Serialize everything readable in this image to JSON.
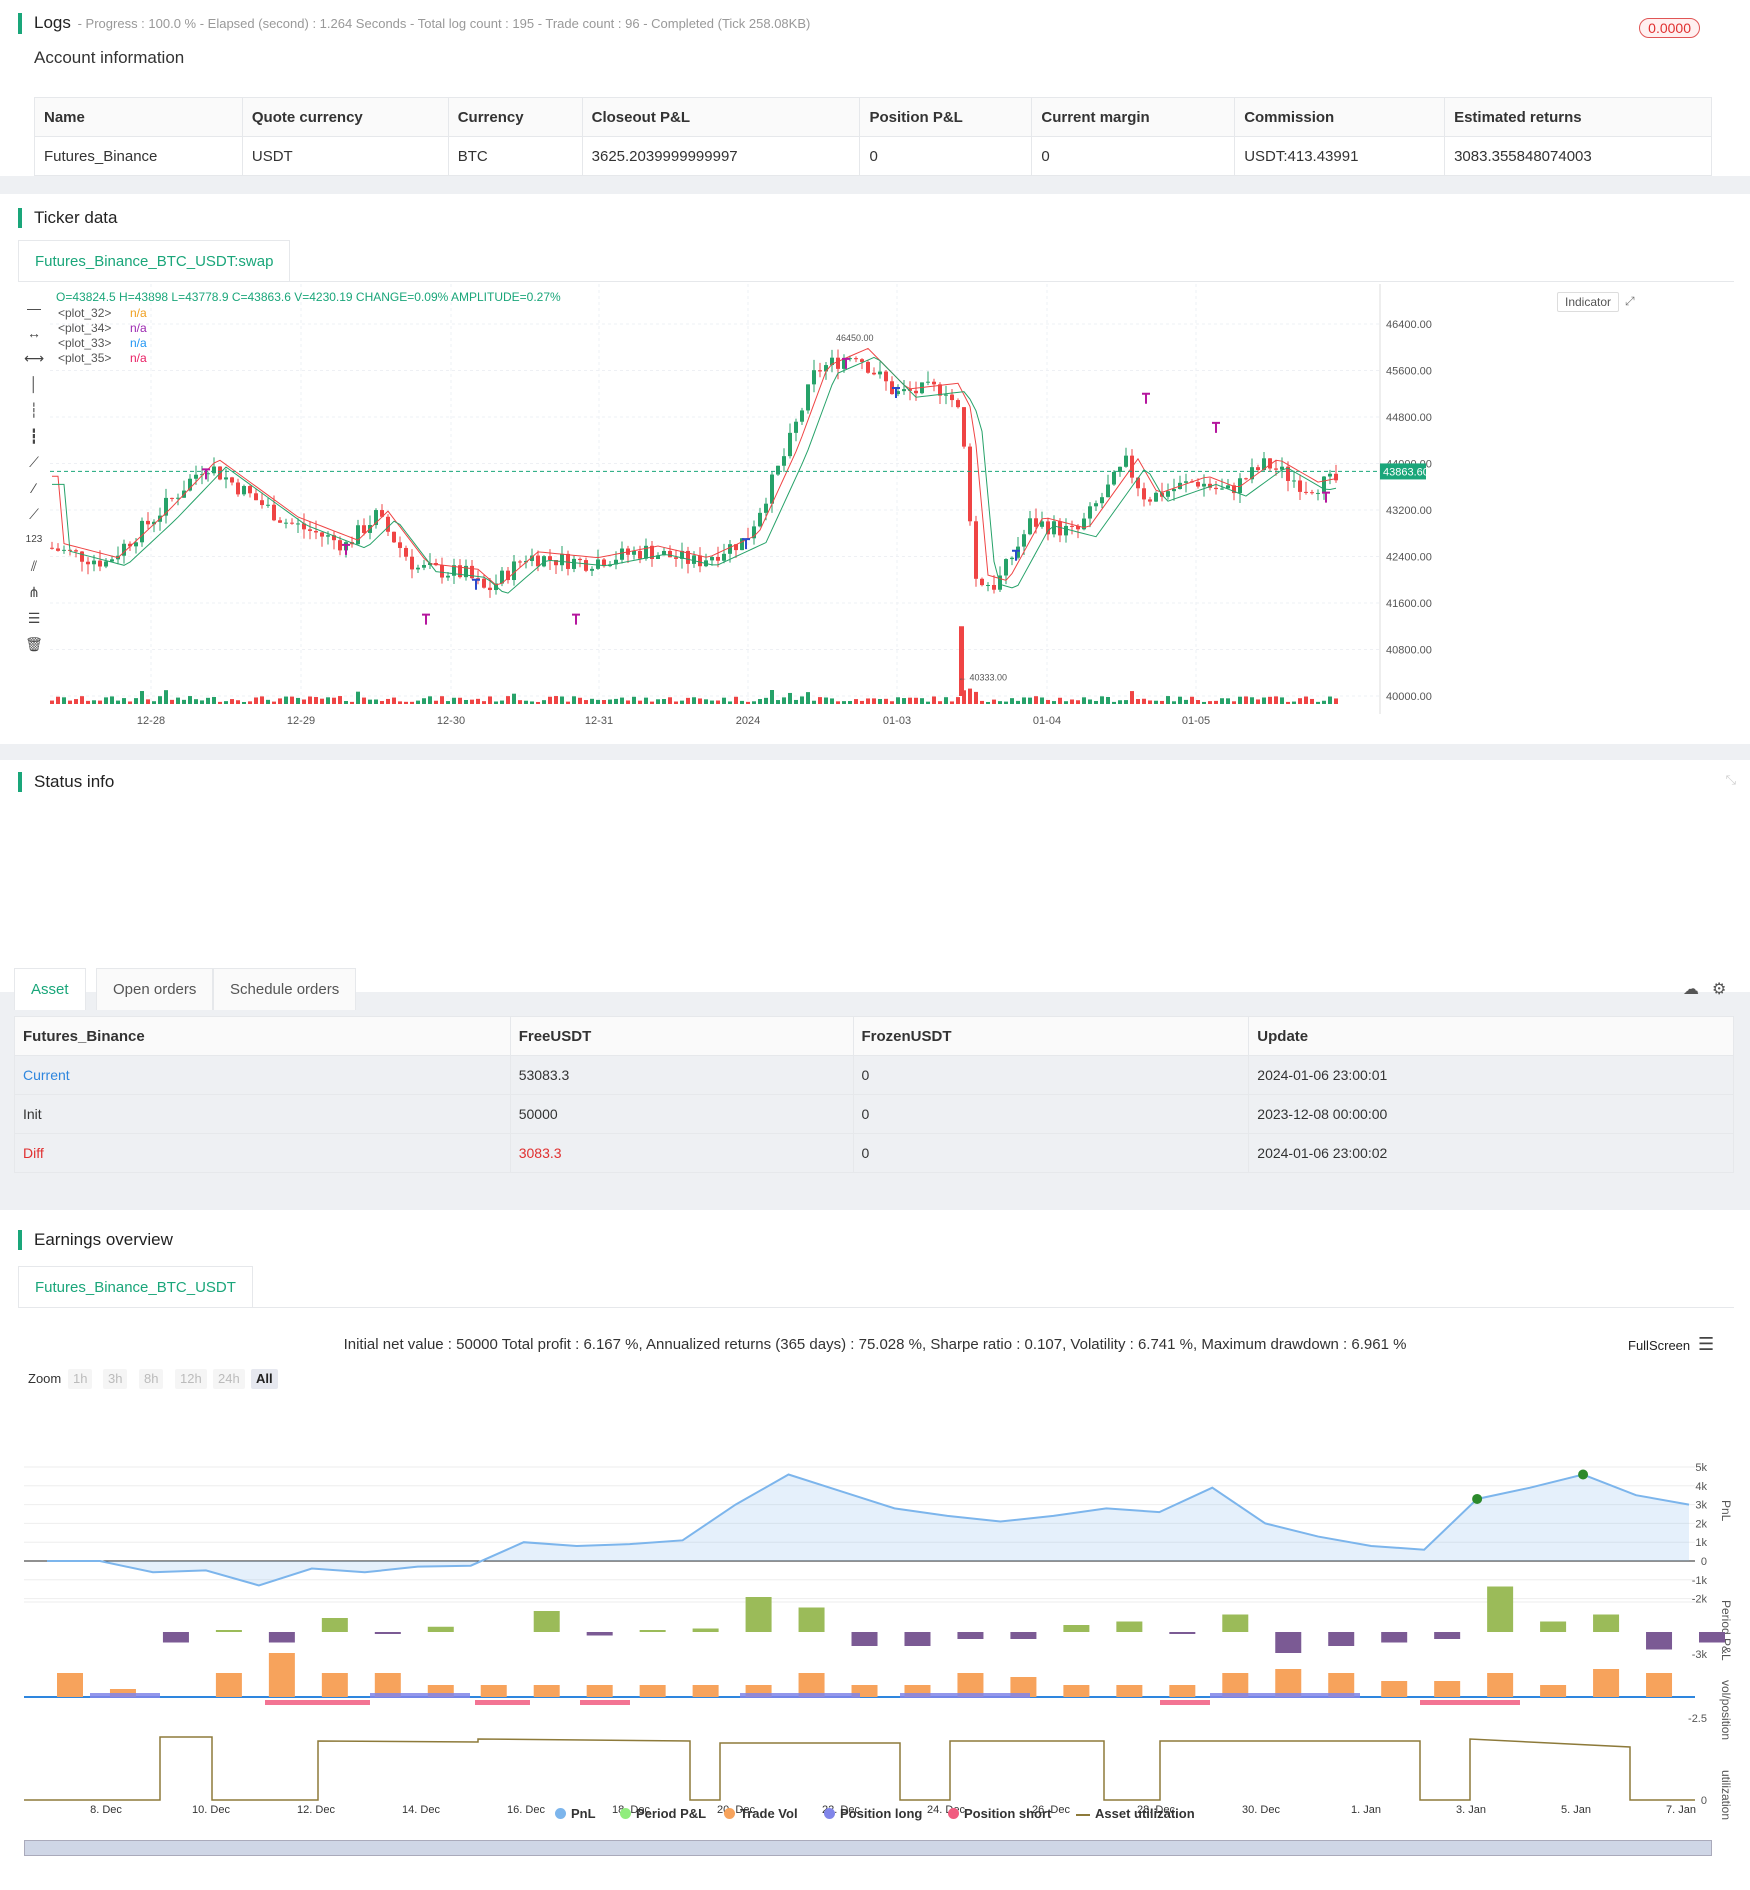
{
  "logs": {
    "title": "Logs",
    "summary": "- Progress : 100.0 % - Elapsed (second) : 1.264 Seconds - Total log count : 195 - Trade count : 96 - Completed (Tick 258.08KB)",
    "badge": "0.0000"
  },
  "account": {
    "title": "Account information",
    "headers": [
      "Name",
      "Quote currency",
      "Currency",
      "Closeout P&L",
      "Position P&L",
      "Current margin",
      "Commission",
      "Estimated returns"
    ],
    "row": [
      "Futures_Binance",
      "USDT",
      "BTC",
      "3625.2039999999997",
      "0",
      "0",
      "USDT:413.43991",
      "3083.355848074003"
    ]
  },
  "ticker": {
    "title": "Ticker data",
    "tab": "Futures_Binance_BTC_USDT:swap",
    "ohlc": "O=43824.5 H=43898 L=43778.9 C=43863.6 V=4230.19 CHANGE=0.09% AMPLITUDE=0.27%",
    "plots": [
      {
        "name": "<plot_32>",
        "value": "n/a",
        "color": "#f0a020"
      },
      {
        "name": "<plot_34>",
        "value": "n/a",
        "color": "#9c27b0"
      },
      {
        "name": "<plot_33>",
        "value": "n/a",
        "color": "#2196f3"
      },
      {
        "name": "<plot_35>",
        "value": "n/a",
        "color": "#e91e63"
      }
    ],
    "indicator_btn": "Indicator",
    "price_ticks": [
      "46400.00",
      "45600.00",
      "44800.00",
      "44000.00",
      "43200.00",
      "42400.00",
      "41600.00",
      "40800.00",
      "40000.00"
    ],
    "current_price": "43863.60",
    "high_label": "46450.00",
    "low_label": "40333.00",
    "date_ticks": [
      "12-28",
      "12-29",
      "12-30",
      "12-31",
      "2024",
      "01-03",
      "01-04",
      "01-05"
    ]
  },
  "status": {
    "title": "Status info",
    "tabs": [
      "Asset",
      "Open orders",
      "Schedule orders"
    ],
    "headers": [
      "Futures_Binance",
      "FreeUSDT",
      "FrozenUSDT",
      "Update"
    ],
    "rows": [
      {
        "label": "Current",
        "free": "53083.3",
        "frozen": "0",
        "update": "2024-01-06 23:00:01"
      },
      {
        "label": "Init",
        "free": "50000",
        "frozen": "0",
        "update": "2023-12-08 00:00:00"
      },
      {
        "label": "Diff",
        "free": "3083.3",
        "frozen": "0",
        "update": "2024-01-06 23:00:02"
      }
    ]
  },
  "earnings": {
    "title": "Earnings overview",
    "tab": "Futures_Binance_BTC_USDT",
    "summary": "Initial net value : 50000 Total profit : 6.167 %, Annualized returns (365 days) : 75.028 %, Sharpe ratio : 0.107, Volatility : 6.741 %, Maximum drawdown : 6.961 %",
    "fullscreen": "FullScreen",
    "zoom_label": "Zoom",
    "zoom_buttons": [
      "1h",
      "3h",
      "8h",
      "12h",
      "24h",
      "All"
    ],
    "pnl_ticks": [
      "5k",
      "4k",
      "3k",
      "2k",
      "1k",
      "0",
      "-1k",
      "-2k"
    ],
    "axis_names": [
      "PnL",
      "Period P&L",
      "vol/position",
      "utilization"
    ],
    "period_tick": "-3k",
    "vol_tick": "-2.5",
    "util_tick": "0",
    "date_ticks": [
      "8. Dec",
      "10. Dec",
      "12. Dec",
      "14. Dec",
      "16. Dec",
      "18. Dec",
      "20. Dec",
      "22. Dec",
      "24. Dec",
      "26. Dec",
      "28. Dec",
      "30. Dec",
      "1. Jan",
      "3. Jan",
      "5. Jan",
      "7. Jan"
    ],
    "legend": [
      {
        "label": "PnL",
        "color": "#7cb5ec"
      },
      {
        "label": "Period P&L",
        "color": "#90ed7d"
      },
      {
        "label": "Trade Vol",
        "color": "#f7a35c"
      },
      {
        "label": "Position long",
        "color": "#8085e9"
      },
      {
        "label": "Position short",
        "color": "#f15c80"
      },
      {
        "label": "Asset utilization",
        "color": "#8d7a3a"
      }
    ]
  },
  "chart_data": [
    {
      "type": "line",
      "title": "",
      "xlabel": "",
      "ylabel": "PnL",
      "x": [
        "7. Dec",
        "8. Dec",
        "9. Dec",
        "10. Dec",
        "11. Dec",
        "12. Dec",
        "13. Dec",
        "14. Dec",
        "15. Dec",
        "16. Dec",
        "17. Dec",
        "18. Dec",
        "19. Dec",
        "20. Dec",
        "21. Dec",
        "22. Dec",
        "23. Dec",
        "24. Dec",
        "25. Dec",
        "26. Dec",
        "27. Dec",
        "28. Dec",
        "29. Dec",
        "30. Dec",
        "31. Dec",
        "1. Jan",
        "2. Jan",
        "3. Jan",
        "4. Jan",
        "5. Jan",
        "6. Jan",
        "7. Jan"
      ],
      "values": [
        0,
        0,
        -600,
        -500,
        -1300,
        -400,
        -600,
        -300,
        -250,
        1000,
        800,
        900,
        1100,
        3000,
        4600,
        3700,
        2800,
        2400,
        2100,
        2400,
        2800,
        2600,
        3900,
        2000,
        1300,
        800,
        600,
        3300,
        3900,
        4600,
        3500,
        3000
      ],
      "ylim": [
        -2000,
        5000
      ]
    }
  ]
}
